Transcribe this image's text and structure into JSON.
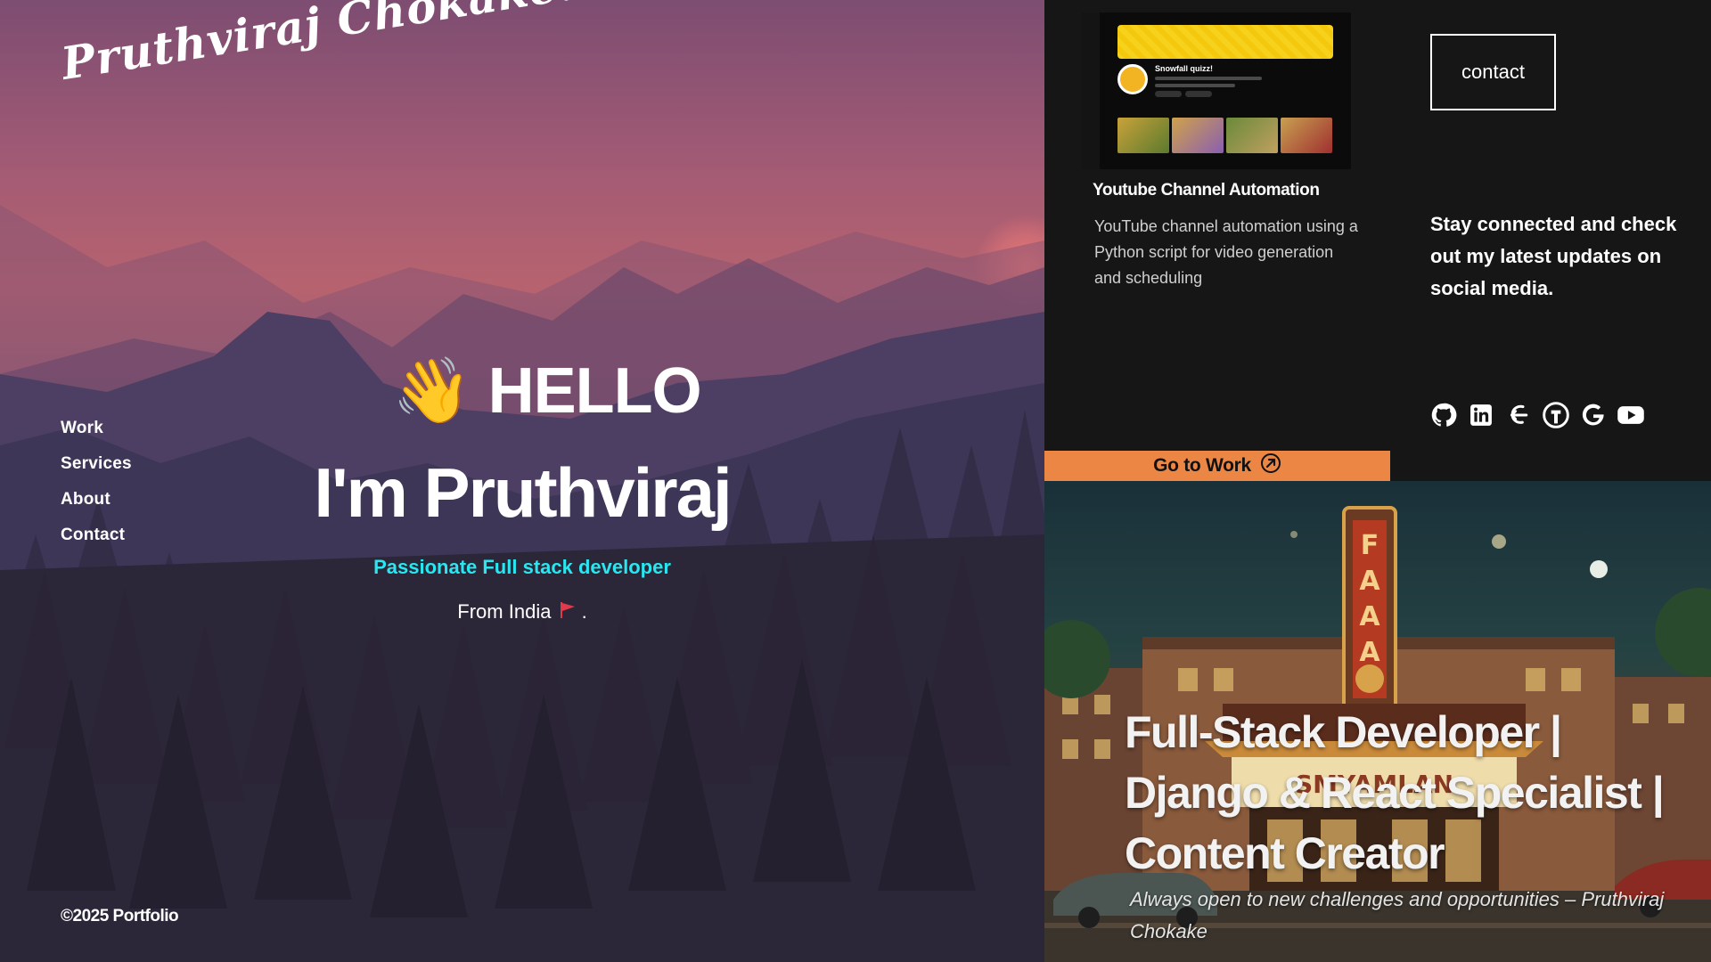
{
  "brand": {
    "logo_text": "Pruthviraj Chokake."
  },
  "nav": {
    "items": [
      {
        "label": "Work"
      },
      {
        "label": "Services"
      },
      {
        "label": "About"
      },
      {
        "label": "Contact"
      }
    ]
  },
  "hero": {
    "greeting": "HELLO",
    "wave_emoji": "👋",
    "name_line": "I'm Pruthviraj",
    "tagline": "Passionate Full stack developer",
    "from_text": "From India",
    "from_suffix": ".",
    "flag_icon": "red-flag-icon",
    "tagline_color": "#29e7f0"
  },
  "footer": {
    "copyright": "©2025 Portfolio"
  },
  "project": {
    "title": "Youtube Channel Automation",
    "description": "YouTube channel automation using a Python script for video generation and scheduling",
    "thumbnail_channel_name": "Snowfall quizz!"
  },
  "contact": {
    "button_label": "contact"
  },
  "social": {
    "text": "Stay connected and check out my latest updates on social media.",
    "icons": [
      "github-icon",
      "linkedin-icon",
      "codechef-icon",
      "leetcode-icon",
      "google-icon",
      "youtube-icon"
    ]
  },
  "cta": {
    "go_to_work_label": "Go to Work",
    "accent_color": "#ec8644"
  },
  "headline": {
    "text": "Full-Stack Developer | Django & React Specialist | Content Creator",
    "quote": "Always open to new challenges and opportunities – Pruthviraj Chokake",
    "marquee_text": "SMYAMLAN"
  }
}
